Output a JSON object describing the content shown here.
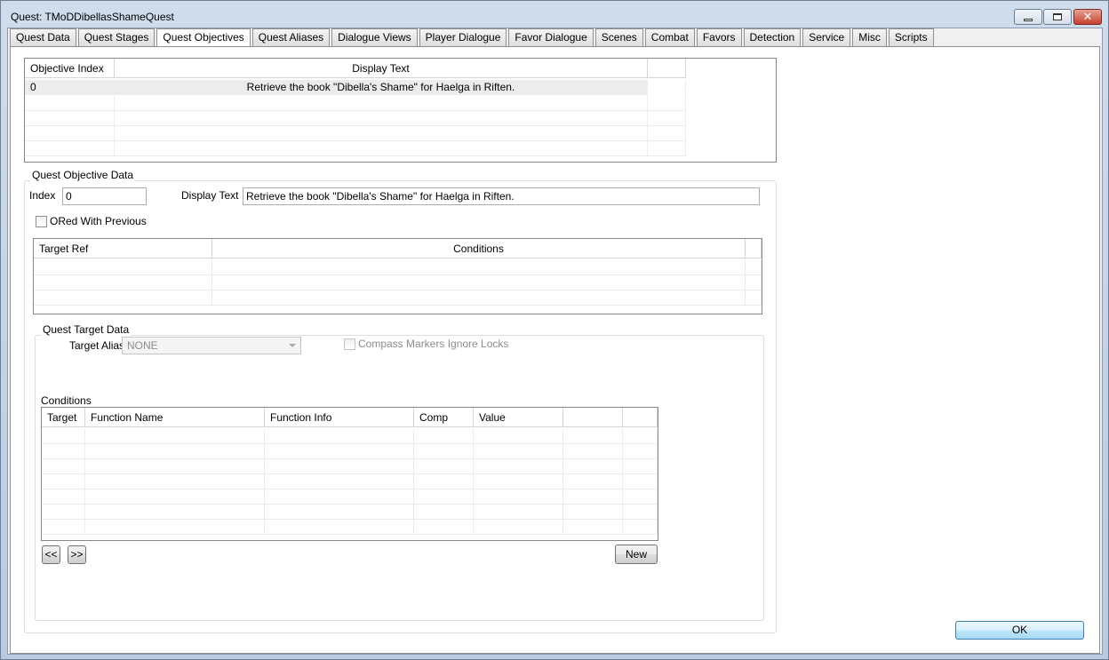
{
  "window": {
    "title": "Quest: TMoDDibellasShameQuest",
    "min_glyph": "",
    "close_glyph": "✕"
  },
  "tabs": [
    {
      "label": "Quest Data"
    },
    {
      "label": "Quest Stages"
    },
    {
      "label": "Quest Objectives",
      "active": true
    },
    {
      "label": "Quest Aliases"
    },
    {
      "label": "Dialogue Views"
    },
    {
      "label": "Player Dialogue"
    },
    {
      "label": "Favor Dialogue"
    },
    {
      "label": "Scenes"
    },
    {
      "label": "Combat"
    },
    {
      "label": "Favors"
    },
    {
      "label": "Detection"
    },
    {
      "label": "Service"
    },
    {
      "label": "Misc"
    },
    {
      "label": "Scripts"
    }
  ],
  "objectives_table": {
    "headers": [
      "Objective Index",
      "Display Text"
    ],
    "rows": [
      {
        "index": "0",
        "display_text": "Retrieve the book \"Dibella's Shame\" for Haelga in Riften."
      }
    ]
  },
  "objective_data": {
    "group_label": "Quest Objective Data",
    "index_label": "Index",
    "index_value": "0",
    "display_text_label": "Display Text",
    "display_text_value": "Retrieve the book \"Dibella's Shame\" for Haelga in Riften.",
    "ored_label": "ORed With Previous",
    "ored_checked": false
  },
  "targets_table": {
    "headers": [
      "Target Ref",
      "Conditions"
    ]
  },
  "target_data": {
    "group_label": "Quest Target Data",
    "alias_label": "Target Alias",
    "alias_value": "NONE",
    "compass_label": "Compass Markers Ignore Locks",
    "compass_checked": false
  },
  "conditions": {
    "label": "Conditions",
    "headers": [
      "Target",
      "Function Name",
      "Function Info",
      "Comp",
      "Value",
      "",
      ""
    ],
    "prev_button": "<<",
    "next_button": ">>",
    "new_button": "New"
  },
  "ok_button": "OK",
  "colors": {
    "window_frame": "#b9cbe0",
    "close_button": "#c4412b",
    "selected_row": "#ececec"
  }
}
